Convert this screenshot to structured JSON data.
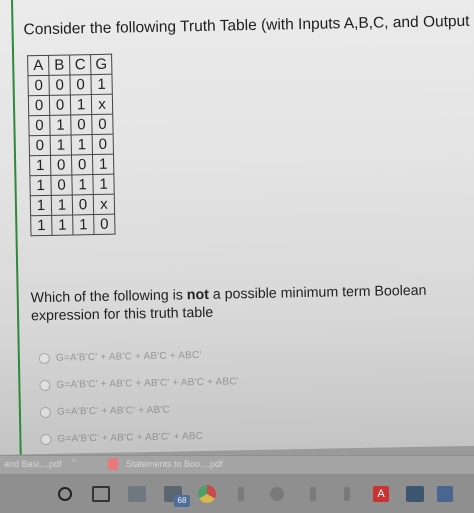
{
  "question": {
    "title": "Consider the following Truth Table (with Inputs A,B,C, and Output G)",
    "prompt_before": "Which of the following is ",
    "prompt_bold": "not",
    "prompt_after": " a possible minimum term Boolean expression for this truth table"
  },
  "truth_table": {
    "headers": [
      "A",
      "B",
      "C",
      "G"
    ],
    "rows": [
      [
        "0",
        "0",
        "0",
        "1"
      ],
      [
        "0",
        "0",
        "1",
        "x"
      ],
      [
        "0",
        "1",
        "0",
        "0"
      ],
      [
        "0",
        "1",
        "1",
        "0"
      ],
      [
        "1",
        "0",
        "0",
        "1"
      ],
      [
        "1",
        "0",
        "1",
        "1"
      ],
      [
        "1",
        "1",
        "0",
        "x"
      ],
      [
        "1",
        "1",
        "1",
        "0"
      ]
    ]
  },
  "options": [
    "G=A'B'C' + AB'C + AB'C + ABC'",
    "G=A'B'C' + AB'C + AB'C' + AB'C + ABC'",
    "G=A'B'C' + AB'C' + AB'C",
    "G=A'B'C' + AB'C + AB'C' + ABC"
  ],
  "downloads": {
    "item1": "and Basi....pdf",
    "item2": "Statements to Boo....pdf"
  },
  "taskbar": {
    "badge": "68"
  }
}
